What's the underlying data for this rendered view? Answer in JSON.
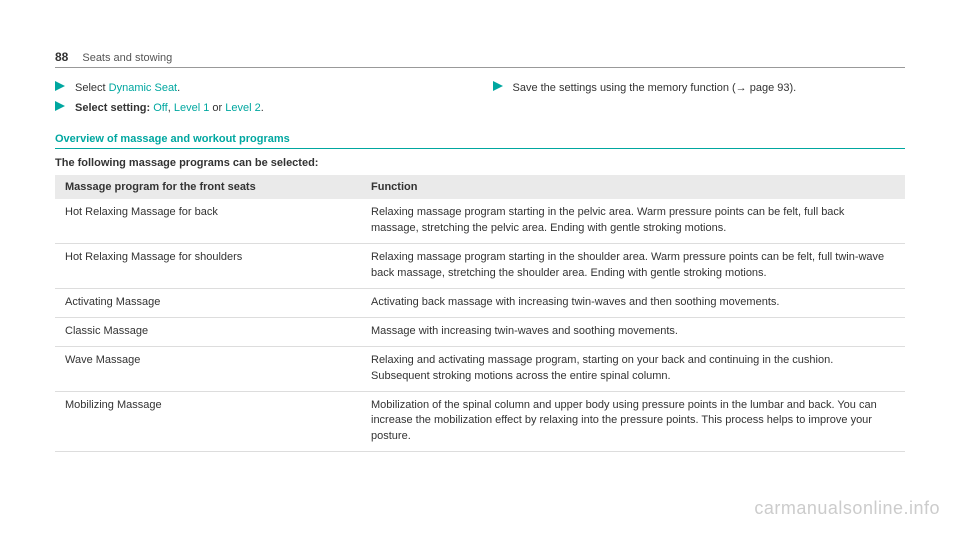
{
  "header": {
    "page_number": "88",
    "chapter": "Seats and stowing"
  },
  "left_steps": [
    {
      "pre": "Select ",
      "link": "Dynamic Seat",
      "post": "."
    },
    {
      "bold_pre": "Select setting:",
      "options": " Off, Level 1 or Level 2",
      "post": "."
    }
  ],
  "right_steps": [
    {
      "text": "Save the settings using the memory function (→ page 93)."
    }
  ],
  "section_heading": "Overview of massage and workout programs",
  "subheading": "The following massage programs can be selected:",
  "table": {
    "headers": [
      "Massage program for the front seats",
      "Function"
    ],
    "rows": [
      [
        "Hot Relaxing Massage for back",
        "Relaxing massage program starting in the pelvic area. Warm pressure points can be felt, full back massage, stretching the pelvic area. Ending with gentle stroking motions."
      ],
      [
        "Hot Relaxing Massage for shoulders",
        "Relaxing massage program starting in the shoulder area. Warm pressure points can be felt, full twin-wave back massage, stretching the shoulder area. Ending with gentle stroking motions."
      ],
      [
        "Activating Massage",
        "Activating back massage with increasing twin-waves and then soothing movements."
      ],
      [
        "Classic Massage",
        "Massage with increasing twin-waves and soothing movements."
      ],
      [
        "Wave Massage",
        "Relaxing and activating massage program, starting on your back and continuing in the cushion. Subsequent stroking motions across the entire spinal column."
      ],
      [
        "Mobilizing Massage",
        "Mobilization of the spinal column and upper body using pressure points in the lumbar and back. You can increase the mobilization effect by relaxing into the pressure points. This process helps to improve your posture."
      ]
    ]
  },
  "setting_options": {
    "off": "Off",
    "level1": "Level 1",
    "level2": "Level 2",
    "or": " or "
  },
  "watermark": "carmanualsonline.info"
}
